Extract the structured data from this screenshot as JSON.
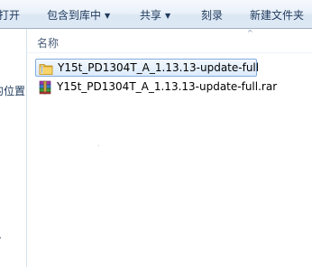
{
  "toolbar": {
    "open_label": "打开",
    "include_label": "包含到库中",
    "share_label": "共享",
    "burn_label": "刻录",
    "new_folder_label": "新建文件夹"
  },
  "nav_pane": {
    "partial_text": "的位置",
    "partial_text_2": "ネ"
  },
  "columns": {
    "name": "名称"
  },
  "files": [
    {
      "name": "Y15t_PD1304T_A_1.13.13-update-full",
      "type": "folder",
      "selected": true
    },
    {
      "name": "Y15t_PD1304T_A_1.13.13-update-full.rar",
      "type": "rar-archive",
      "selected": false
    }
  ],
  "colors": {
    "toolbar_text": "#1e395b",
    "selection_border": "#84acdd",
    "folder_yellow": "#e8b83a"
  }
}
